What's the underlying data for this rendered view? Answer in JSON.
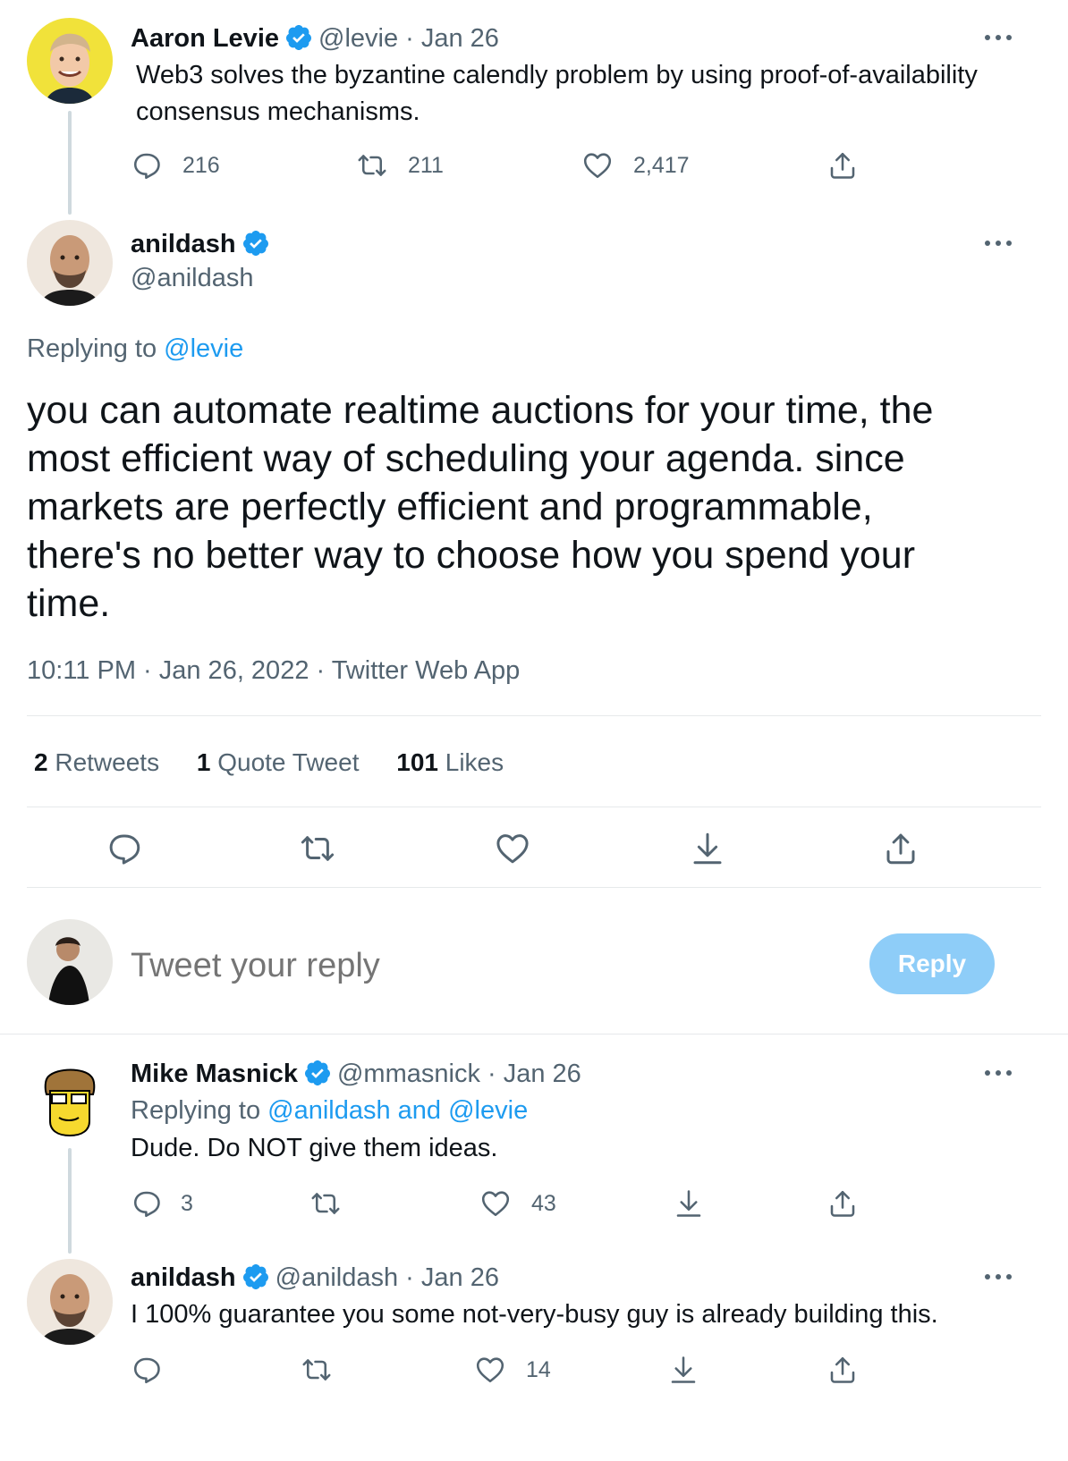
{
  "colors": {
    "accent": "#1d9bf0",
    "muted": "#536471",
    "reply_button_bg": "#8ecdf8"
  },
  "tweet1": {
    "name": "Aaron Levie",
    "handle_date": "@levie · Jan 26",
    "text_line1": "Web3 solves the byzantine calendly problem by using proof-of-availability",
    "text_line2": "consensus mechanisms.",
    "replies": "216",
    "retweets": "211",
    "likes": "2,417"
  },
  "main": {
    "name": "anildash",
    "handle": "@anildash",
    "replying_label": "Replying to",
    "replying_handle": "@levie",
    "text_lines": [
      "you can automate realtime auctions for your time, the",
      "most efficient way of scheduling your agenda. since",
      "markets are perfectly efficient and programmable,",
      "there's no better way to choose how you spend your",
      "time."
    ],
    "meta": "10:11 PM · Jan 26, 2022 · Twitter Web App",
    "stats": {
      "retweets_count": "2",
      "retweets_label": "Retweets",
      "quotes_count": "1",
      "quotes_label": "Quote Tweet",
      "likes_count": "101",
      "likes_label": "Likes"
    }
  },
  "composer": {
    "placeholder": "Tweet your reply",
    "button": "Reply"
  },
  "reply1": {
    "name": "Mike Masnick",
    "handle_date": "@mmasnick · Jan 26",
    "replying_label": "Replying to",
    "replying_handles": "@anildash and @levie",
    "text": "Dude. Do NOT give them ideas.",
    "replies": "3",
    "likes": "43"
  },
  "reply2": {
    "name": "anildash",
    "handle_date": "@anildash · Jan 26",
    "text": "I 100% guarantee you some not-very-busy guy is already building this.",
    "likes": "14"
  }
}
